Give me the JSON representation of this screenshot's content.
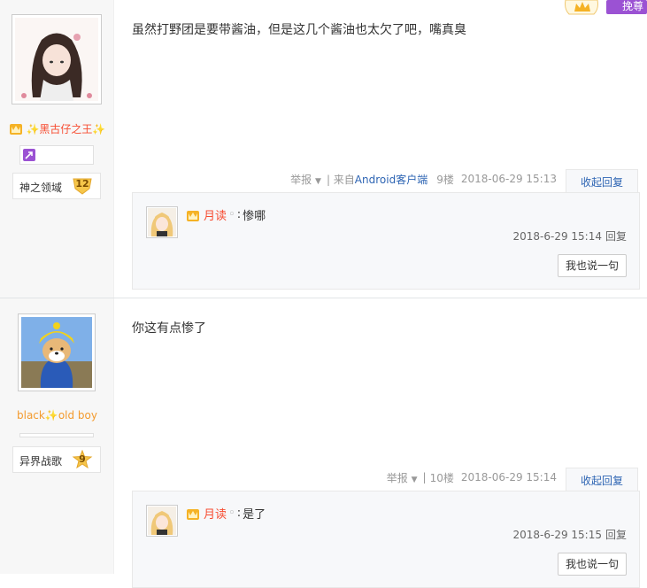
{
  "top_badge": {
    "label": "挽尊"
  },
  "posts": [
    {
      "user": {
        "name_prefix": "✨",
        "name": "黑古仔之王",
        "name_suffix": "✨"
      },
      "forum": {
        "name": "神之领域",
        "level": "12"
      },
      "content": "虽然打野团是要带酱油，但是这几个酱油也太欠了吧，嘴真臭",
      "tail": {
        "report": "举报",
        "source_prefix": "| 来自",
        "source_link": "Android客户端",
        "floor": "9楼",
        "time": "2018-06-29 15:13",
        "collapse": "收起回复"
      },
      "reply": {
        "name": "月读",
        "dot": "◦",
        "sep": ":",
        "text": "惨哪",
        "time": "2018-6-29 15:14",
        "reply_link": "回复",
        "say_button": "我也说一句"
      }
    },
    {
      "user": {
        "name_prefix": "black",
        "name_mid": "✨",
        "name": "old boy"
      },
      "forum": {
        "name": "异界战歌",
        "level": "9"
      },
      "content": "你这有点惨了",
      "tail": {
        "report": "举报",
        "separator": "|",
        "floor": "10楼",
        "time": "2018-06-29 15:14",
        "collapse": "收起回复"
      },
      "reply": {
        "name": "月读",
        "dot": "◦",
        "sep": ":",
        "text": "是了",
        "time": "2018-6-29 15:15",
        "reply_link": "回复",
        "say_button": "我也说一句"
      }
    }
  ]
}
